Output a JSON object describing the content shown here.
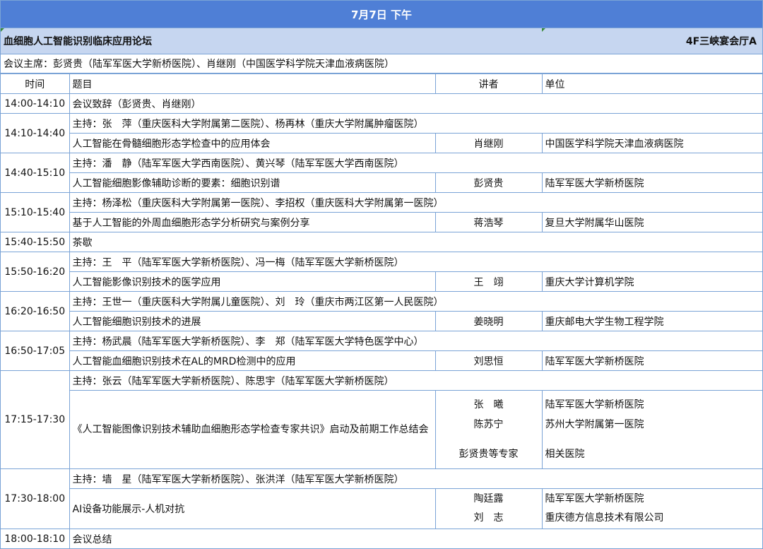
{
  "header": {
    "date": "7月7日  下午"
  },
  "forum": {
    "title": "血细胞人工智能识别临床应用论坛",
    "location": "4F三峡宴会厅A"
  },
  "chairs_line": "会议主席：彭贤贵（陆军军医大学新桥医院）、肖继刚（中国医学科学院天津血液病医院）",
  "columns": {
    "time": "时间",
    "topic": "题目",
    "speaker": "讲者",
    "unit": "单位"
  },
  "rows": {
    "r1": {
      "time": "14:00-14:10",
      "topic": "会议致辞（彭贤贵、肖继刚）"
    },
    "r2": {
      "time": "14:10-14:40",
      "host": "主持：张　萍（重庆医科大学附属第二医院）、杨再林（重庆大学附属肿瘤医院）",
      "topic": "人工智能在骨髓细胞形态学检查中的应用体会",
      "speaker": "肖继刚",
      "unit": "中国医学科学院天津血液病医院"
    },
    "r3": {
      "time": "14:40-15:10",
      "host": "主持：潘　静（陆军军医大学西南医院）、黄兴琴（陆军军医大学西南医院）",
      "topic": "人工智能细胞影像辅助诊断的要素：细胞识别谱",
      "speaker": "彭贤贵",
      "unit": "陆军军医大学新桥医院"
    },
    "r4": {
      "time": "15:10-15:40",
      "host": "主持：杨泽松（重庆医科大学附属第一医院）、李招权（重庆医科大学附属第一医院）",
      "topic": "基于人工智能的外周血细胞形态学分析研究与案例分享",
      "speaker": "蒋浩琴",
      "unit": "复旦大学附属华山医院"
    },
    "r5": {
      "time": "15:40-15:50",
      "topic": "茶歇"
    },
    "r6": {
      "time": "15:50-16:20",
      "host": "主持：王　平（陆军军医大学新桥医院）、冯一梅（陆军军医大学新桥医院）",
      "topic": "人工智能影像识别技术的医学应用",
      "speaker": "王　翊",
      "unit": "重庆大学计算机学院"
    },
    "r7": {
      "time": "16:20-16:50",
      "host": "主持：王世一（重庆医科大学附属儿童医院）、刘　玲（重庆市两江区第一人民医院）",
      "topic": "人工智能细胞识别技术的进展",
      "speaker": "姜晓明",
      "unit": "重庆邮电大学生物工程学院"
    },
    "r8": {
      "time": "16:50-17:05",
      "host": "主持：杨武晨（陆军军医大学新桥医院）、李　郑（陆军军医大学特色医学中心）",
      "topic": "人工智能血细胞识别技术在AL的MRD检测中的应用",
      "speaker": "刘思恒",
      "unit": "陆军军医大学新桥医院"
    },
    "r9": {
      "time": "17:15-17:30",
      "host": "主持：张云（陆军军医大学新桥医院）、陈思宇（陆军军医大学新桥医院）",
      "topic": "《人工智能图像识别技术辅助血细胞形态学检查专家共识》启动及前期工作总结会",
      "speakers": [
        "张　曦",
        "陈苏宁",
        "彭贤贵等专家"
      ],
      "units": [
        "陆军军医大学新桥医院",
        "苏州大学附属第一医院",
        "相关医院"
      ]
    },
    "r10": {
      "time": "17:30-18:00",
      "host": "主持：墙　星（陆军军医大学新桥医院）、张洪洋（陆军军医大学新桥医院）",
      "topic": "AI设备功能展示-人机对抗",
      "speakers": [
        "陶廷露",
        "刘　志"
      ],
      "units": [
        "陆军军医大学新桥医院",
        "重庆德方信息技术有限公司"
      ]
    },
    "r11": {
      "time": "18:00-18:10",
      "topic": "会议总结"
    }
  },
  "colors": {
    "date_bar": "#4f7fd6",
    "forum_bar": "#c6d6f0",
    "grid": "#7aa3d6"
  }
}
